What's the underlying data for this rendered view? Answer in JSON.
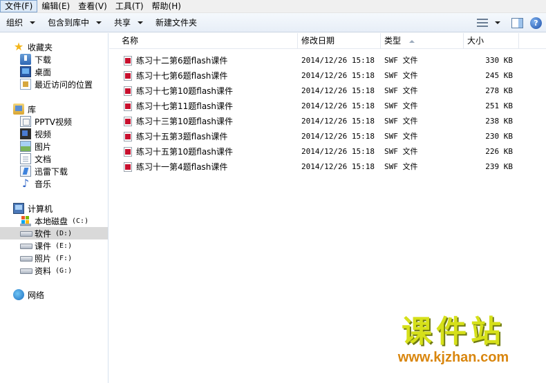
{
  "menu": [
    {
      "label": "文件(F)"
    },
    {
      "label": "编辑(E)"
    },
    {
      "label": "查看(V)"
    },
    {
      "label": "工具(T)"
    },
    {
      "label": "帮助(H)"
    }
  ],
  "toolbar": {
    "organize": "组织",
    "include_library": "包含到库中",
    "share": "共享",
    "new_folder": "新建文件夹",
    "help": "?"
  },
  "nav": {
    "favorites": "收藏夹",
    "favorites_items": [
      "下载",
      "桌面",
      "最近访问的位置"
    ],
    "libraries": "库",
    "library_items": [
      "PPTV视频",
      "视频",
      "图片",
      "文档",
      "迅雷下载",
      "音乐"
    ],
    "computer": "计算机",
    "drives": [
      {
        "name": "本地磁盘",
        "letter": "(C:)"
      },
      {
        "name": "软件",
        "letter": "(D:)"
      },
      {
        "name": "课件",
        "letter": "(E:)"
      },
      {
        "name": "照片",
        "letter": "(F:)"
      },
      {
        "name": "资料",
        "letter": "(G:)"
      }
    ],
    "network": "网络"
  },
  "columns": {
    "name": "名称",
    "modified": "修改日期",
    "type": "类型",
    "size": "大小"
  },
  "files": [
    {
      "name": "练习十二第6题flash课件",
      "modified": "2014/12/26 15:18",
      "type": "SWF 文件",
      "size": "330 KB"
    },
    {
      "name": "练习十七第6题flash课件",
      "modified": "2014/12/26 15:18",
      "type": "SWF 文件",
      "size": "245 KB"
    },
    {
      "name": "练习十七第10题flash课件",
      "modified": "2014/12/26 15:18",
      "type": "SWF 文件",
      "size": "278 KB"
    },
    {
      "name": "练习十七第11题flash课件",
      "modified": "2014/12/26 15:18",
      "type": "SWF 文件",
      "size": "251 KB"
    },
    {
      "name": "练习十三第10题flash课件",
      "modified": "2014/12/26 15:18",
      "type": "SWF 文件",
      "size": "238 KB"
    },
    {
      "name": "练习十五第3题flash课件",
      "modified": "2014/12/26 15:18",
      "type": "SWF 文件",
      "size": "230 KB"
    },
    {
      "name": "练习十五第10题flash课件",
      "modified": "2014/12/26 15:18",
      "type": "SWF 文件",
      "size": "226 KB"
    },
    {
      "name": "练习十一第4题flash课件",
      "modified": "2014/12/26 15:18",
      "type": "SWF 文件",
      "size": "239 KB"
    }
  ],
  "watermark": {
    "title": "课件站",
    "url": "www.kjzhan.com"
  }
}
